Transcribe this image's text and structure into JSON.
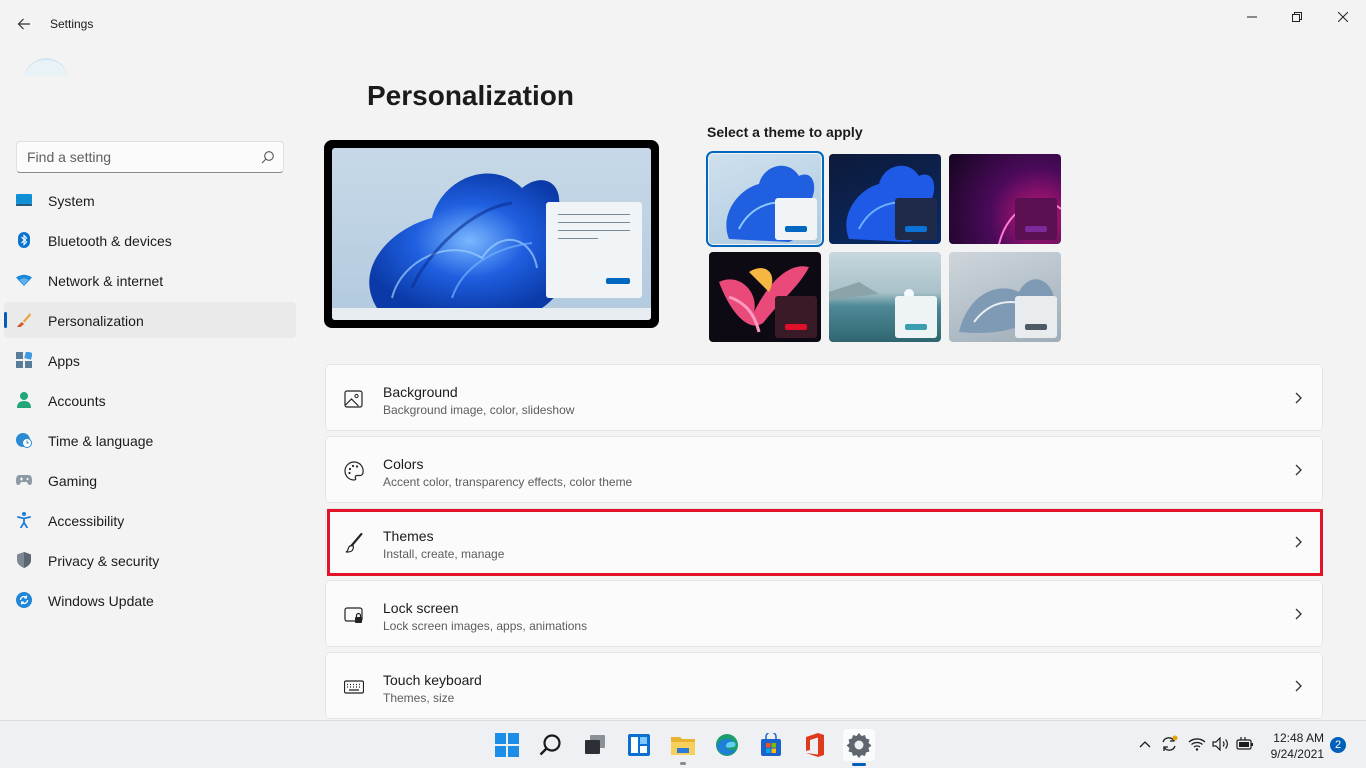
{
  "window": {
    "title": "Settings",
    "controls": {
      "minimize": "minimize-icon",
      "maximize": "restore-icon",
      "close": "close-icon"
    }
  },
  "search": {
    "placeholder": "Find a setting",
    "value": ""
  },
  "sidebar": {
    "items": [
      {
        "label": "System",
        "icon": "system-icon",
        "active": false
      },
      {
        "label": "Bluetooth & devices",
        "icon": "bluetooth-icon",
        "active": false
      },
      {
        "label": "Network & internet",
        "icon": "wifi-icon",
        "active": false
      },
      {
        "label": "Personalization",
        "icon": "brush-icon",
        "active": true
      },
      {
        "label": "Apps",
        "icon": "apps-icon",
        "active": false
      },
      {
        "label": "Accounts",
        "icon": "person-icon",
        "active": false
      },
      {
        "label": "Time & language",
        "icon": "globe-clock-icon",
        "active": false
      },
      {
        "label": "Gaming",
        "icon": "gamepad-icon",
        "active": false
      },
      {
        "label": "Accessibility",
        "icon": "accessibility-icon",
        "active": false
      },
      {
        "label": "Privacy & security",
        "icon": "shield-icon",
        "active": false
      },
      {
        "label": "Windows Update",
        "icon": "update-icon",
        "active": false
      }
    ]
  },
  "main": {
    "title": "Personalization",
    "themes_heading": "Select a theme to apply",
    "themes": [
      {
        "name": "windows-light",
        "selected": true
      },
      {
        "name": "windows-dark",
        "selected": false
      },
      {
        "name": "glow",
        "selected": false
      },
      {
        "name": "captured-motion",
        "selected": false
      },
      {
        "name": "sunrise",
        "selected": false
      },
      {
        "name": "flow",
        "selected": false
      }
    ],
    "cards": [
      {
        "title": "Background",
        "subtitle": "Background image, color, slideshow",
        "icon": "image-icon"
      },
      {
        "title": "Colors",
        "subtitle": "Accent color, transparency effects, color theme",
        "icon": "palette-icon"
      },
      {
        "title": "Themes",
        "subtitle": "Install, create, manage",
        "icon": "brush-icon",
        "highlighted": true
      },
      {
        "title": "Lock screen",
        "subtitle": "Lock screen images, apps, animations",
        "icon": "lock-screen-icon"
      },
      {
        "title": "Touch keyboard",
        "subtitle": "Themes, size",
        "icon": "keyboard-icon"
      }
    ]
  },
  "taskbar": {
    "apps": [
      "start-icon",
      "search-icon",
      "task-view-icon",
      "widgets-icon",
      "file-explorer-icon",
      "edge-icon",
      "store-icon",
      "office-icon",
      "settings-icon"
    ],
    "time": "12:48 AM",
    "date": "9/24/2021",
    "notification_count": "2"
  },
  "colors": {
    "accent": "#005fb8",
    "highlight": "#e3132a"
  }
}
